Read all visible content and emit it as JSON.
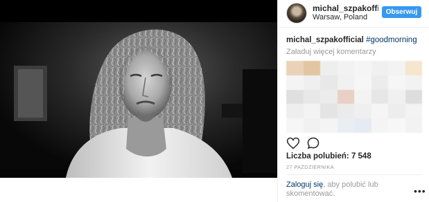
{
  "post": {
    "username": "michal_szpakofficial",
    "location": "Warsaw, Poland",
    "follow_label": "Obserwuj",
    "caption_user": "michal_szpakofficial",
    "caption_tag": "#goodmorning",
    "load_more": "Załaduj więcej komentarzy",
    "likes_label": "Liczba polubień:",
    "likes_count": "7 548",
    "date": "27 PAŹDZIERNIKA",
    "login_link": "Zaloguj się",
    "login_text": ", aby polubić lub skomentować.",
    "more_icon": "ellipsis-icon",
    "like_icon": "heart-icon",
    "comment_icon": "comment-icon"
  },
  "colors": {
    "accent": "#3897f0",
    "link": "#003569",
    "muted": "#999999",
    "text": "#262626",
    "border": "#efefef"
  }
}
